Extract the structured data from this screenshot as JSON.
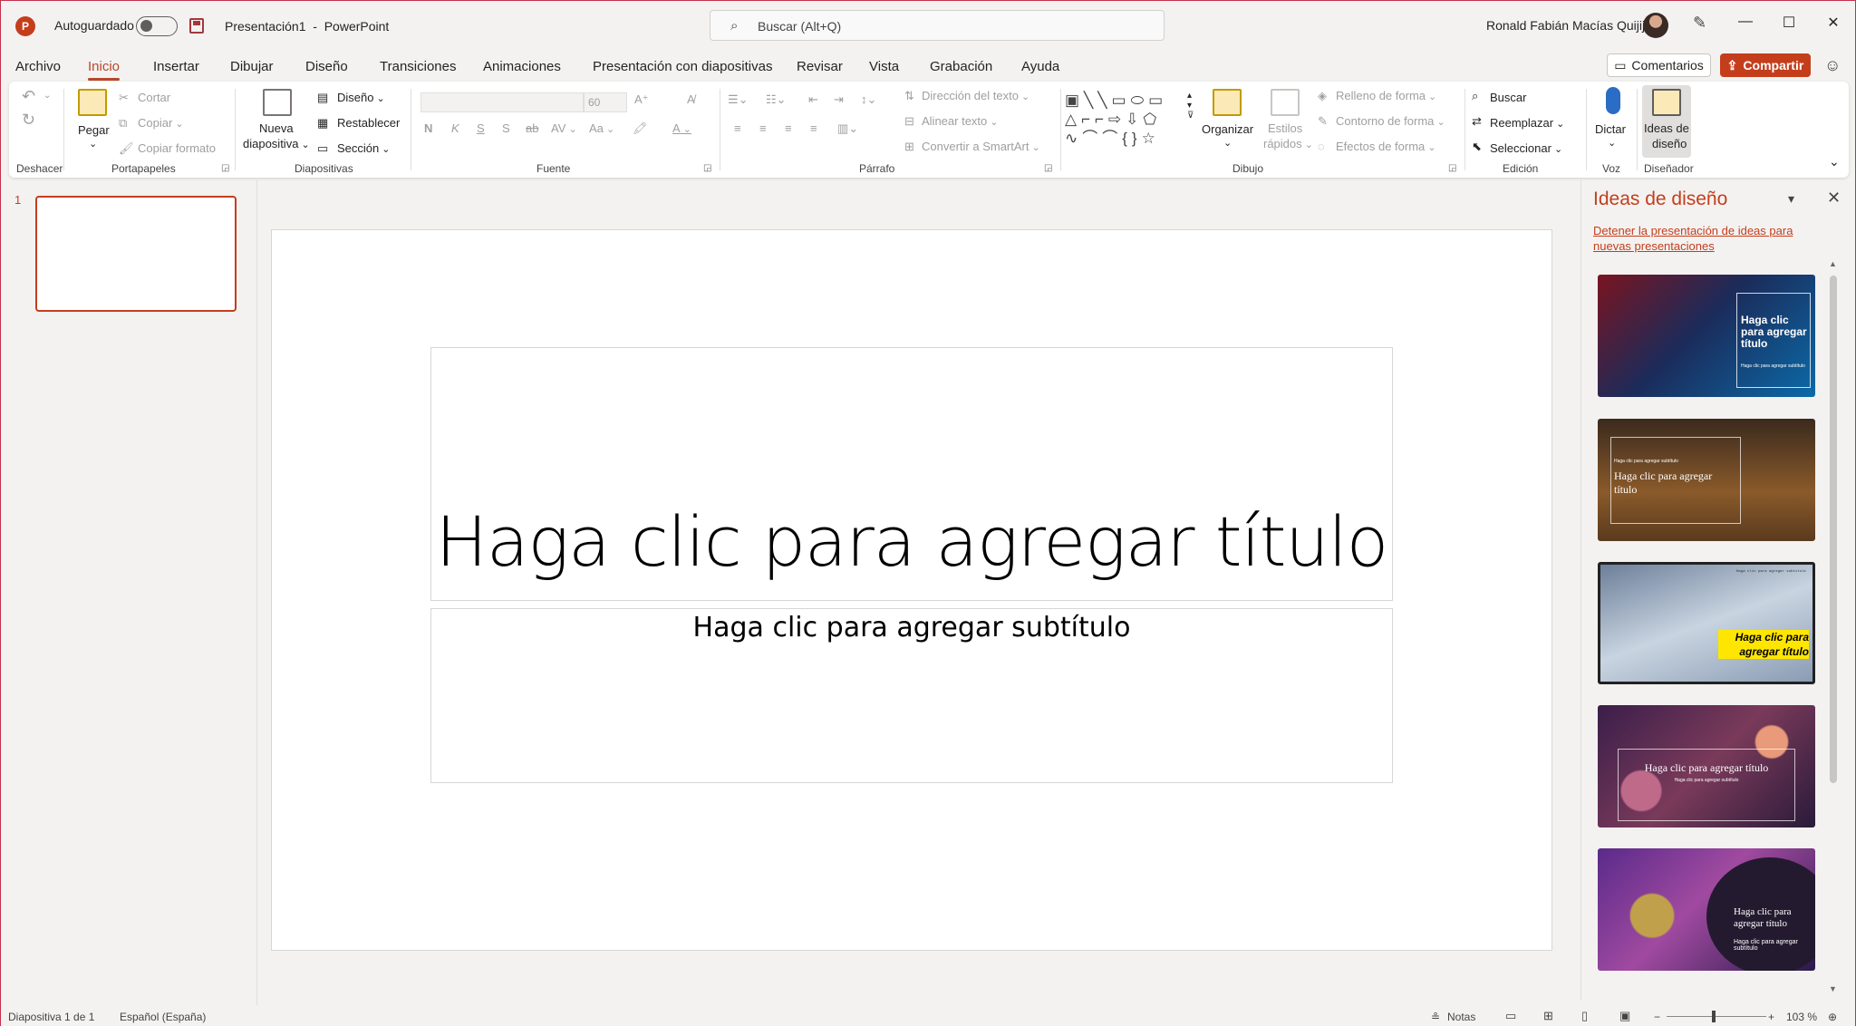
{
  "titlebar": {
    "app_logo": "P",
    "autosave_label": "Autoguardado",
    "document_title": "Presentación1  -  PowerPoint",
    "search_placeholder": "Buscar (Alt+Q)",
    "user_name": "Ronald Fabián Macías Quijije"
  },
  "tabs": [
    "Archivo",
    "Inicio",
    "Insertar",
    "Dibujar",
    "Diseño",
    "Transiciones",
    "Animaciones",
    "Presentación con diapositivas",
    "Revisar",
    "Vista",
    "Grabación",
    "Ayuda"
  ],
  "active_tab": "Inicio",
  "actions": {
    "comments": "Comentarios",
    "share": "Compartir"
  },
  "ribbon": {
    "groups": {
      "undo": "Deshacer",
      "clipboard": "Portapapeles",
      "slides": "Diapositivas",
      "font": "Fuente",
      "paragraph": "Párrafo",
      "drawing": "Dibujo",
      "editing": "Edición",
      "voice": "Voz",
      "designer": "Diseñador"
    },
    "clipboard": {
      "paste": "Pegar",
      "cut": "Cortar",
      "copy": "Copiar",
      "format_painter": "Copiar formato"
    },
    "slides": {
      "new_slide_line1": "Nueva",
      "new_slide_line2": "diapositiva",
      "layout": "Diseño",
      "reset": "Restablecer",
      "section": "Sección"
    },
    "font": {
      "size": "60",
      "bold": "N",
      "italic": "K",
      "underline": "S",
      "shadow": "S",
      "strike": "ab",
      "spacing": "AV",
      "case": "Aa",
      "color": "A"
    },
    "paragraph": {
      "text_direction": "Dirección del texto",
      "align_text": "Alinear texto",
      "smartart": "Convertir a SmartArt"
    },
    "drawing": {
      "arrange": "Organizar",
      "quick_styles_line1": "Estilos",
      "quick_styles_line2": "rápidos",
      "shape_fill": "Relleno de forma",
      "shape_outline": "Contorno de forma",
      "shape_effects": "Efectos de forma"
    },
    "editing": {
      "find": "Buscar",
      "replace": "Reemplazar",
      "select": "Seleccionar"
    },
    "voice": {
      "dictate": "Dictar"
    },
    "designer": {
      "ideas_line1": "Ideas de",
      "ideas_line2": "diseño"
    }
  },
  "thumbnails": {
    "number": "1"
  },
  "slide": {
    "title_placeholder": "Haga clic para agregar título",
    "subtitle_placeholder": "Haga clic para agregar subtítulo"
  },
  "design_pane": {
    "title": "Ideas de diseño",
    "stop_link": "Detener la presentación de ideas para nuevas presentaciones",
    "cards": [
      {
        "title": "Haga clic para agregar título",
        "subtitle": "Haga clic para agregar subtítulo"
      },
      {
        "title": "Haga clic para agregar título",
        "subtitle": "Haga clic para agregar subtítulo"
      },
      {
        "title": "Haga clic para agregar título",
        "subtitle": "Haga clic para agregar subtítulo"
      },
      {
        "title": "Haga clic para agregar título",
        "subtitle": "Haga clic para agregar subtítulo"
      },
      {
        "title": "Haga clic para agregar título",
        "subtitle": "Haga clic para agregar subtítulo"
      }
    ]
  },
  "status": {
    "slide_counter": "Diapositiva 1 de 1",
    "language": "Español (España)",
    "notes": "Notas",
    "zoom": "103 %"
  }
}
